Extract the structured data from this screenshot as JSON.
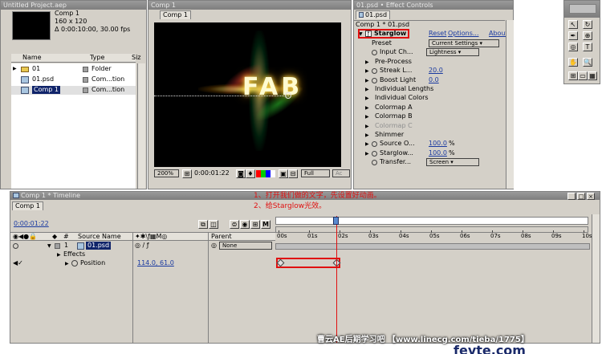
{
  "project": {
    "title": "Untitled Project.aep",
    "info": {
      "name": "Comp 1",
      "size": "160 x 120",
      "duration": "Δ 0:00:10:00, 30.00 fps"
    },
    "columns": {
      "name": "Name",
      "type": "Type",
      "size": "Siz"
    },
    "items": [
      {
        "name": "01",
        "type": "Folder",
        "icon": "folder-icon"
      },
      {
        "name": "01.psd",
        "type": "Com...tion",
        "icon": "composition-icon"
      },
      {
        "name": "Comp 1",
        "type": "Com...tion",
        "icon": "composition-icon"
      }
    ]
  },
  "comp": {
    "title": "Comp 1",
    "tab": "Comp 1",
    "text": "FAB",
    "zoom": "200%",
    "timecode": "0:00:01:22",
    "resolution": "Full",
    "camera": "Ac"
  },
  "effects": {
    "title": "01.psd • Effect Controls",
    "tab": "01.psd",
    "path": "Comp 1 * 01.psd",
    "effect_name": "Starglow",
    "reset": "Reset",
    "options": "Options...",
    "about": "About",
    "rows": [
      {
        "label": "Preset",
        "dropdown": "Current Settings",
        "indent": 1,
        "grayed": false
      },
      {
        "label": "Input Ch...",
        "dropdown": "Lightness",
        "indent": 1,
        "grayed": false,
        "stopwatch": true
      },
      {
        "label": "Pre-Process",
        "indent": 1,
        "expander": true,
        "grayed": false
      },
      {
        "label": "Streak L...",
        "value": "20.0",
        "indent": 1,
        "expander": true,
        "stopwatch": true,
        "grayed": false
      },
      {
        "label": "Boost Light",
        "value": "0.0",
        "indent": 1,
        "expander": true,
        "stopwatch": true,
        "grayed": false
      },
      {
        "label": "Individual Lengths",
        "indent": 1,
        "expander": true,
        "grayed": false
      },
      {
        "label": "Individual Colors",
        "indent": 1,
        "expander": true,
        "grayed": false
      },
      {
        "label": "Colormap A",
        "indent": 1,
        "expander": true,
        "grayed": false
      },
      {
        "label": "Colormap B",
        "indent": 1,
        "expander": true,
        "grayed": false
      },
      {
        "label": "Colormap C",
        "indent": 1,
        "expander": true,
        "grayed": true
      },
      {
        "label": "Shimmer",
        "indent": 1,
        "expander": true,
        "grayed": false
      },
      {
        "label": "Source O...",
        "value": "100.0",
        "unit": "%",
        "indent": 1,
        "expander": true,
        "stopwatch": true,
        "grayed": false
      },
      {
        "label": "Starglow...",
        "value": "100.0",
        "unit": "%",
        "indent": 1,
        "expander": true,
        "stopwatch": true,
        "grayed": false
      },
      {
        "label": "Transfer...",
        "dropdown": "Screen",
        "indent": 1,
        "stopwatch": true,
        "grayed": false
      }
    ]
  },
  "timeline": {
    "title": "Comp 1 * Timeline",
    "tab": "Comp 1",
    "timecode": "0:00:01:22",
    "columns": {
      "source": "Source Name",
      "parent": "Parent"
    },
    "layer": {
      "num": "1",
      "name": "01.psd",
      "parent": "None"
    },
    "effects_label": "Effects",
    "position_label": "Position",
    "position_value": "114.0, 61.0",
    "ruler": [
      "00s",
      "01s",
      "02s",
      "03s",
      "04s",
      "05s",
      "06s",
      "07s",
      "08s",
      "09s",
      "10s"
    ],
    "note1": "1、打开我们做的文字，先设置好动画。",
    "note2": "2、给Starglow光效。",
    "current_time_fraction": 0.19
  },
  "watermark": {
    "text": "曹云AE后期学习吧  【www.linecg.com/tieba/1775】",
    "logo": "fevte.com"
  }
}
